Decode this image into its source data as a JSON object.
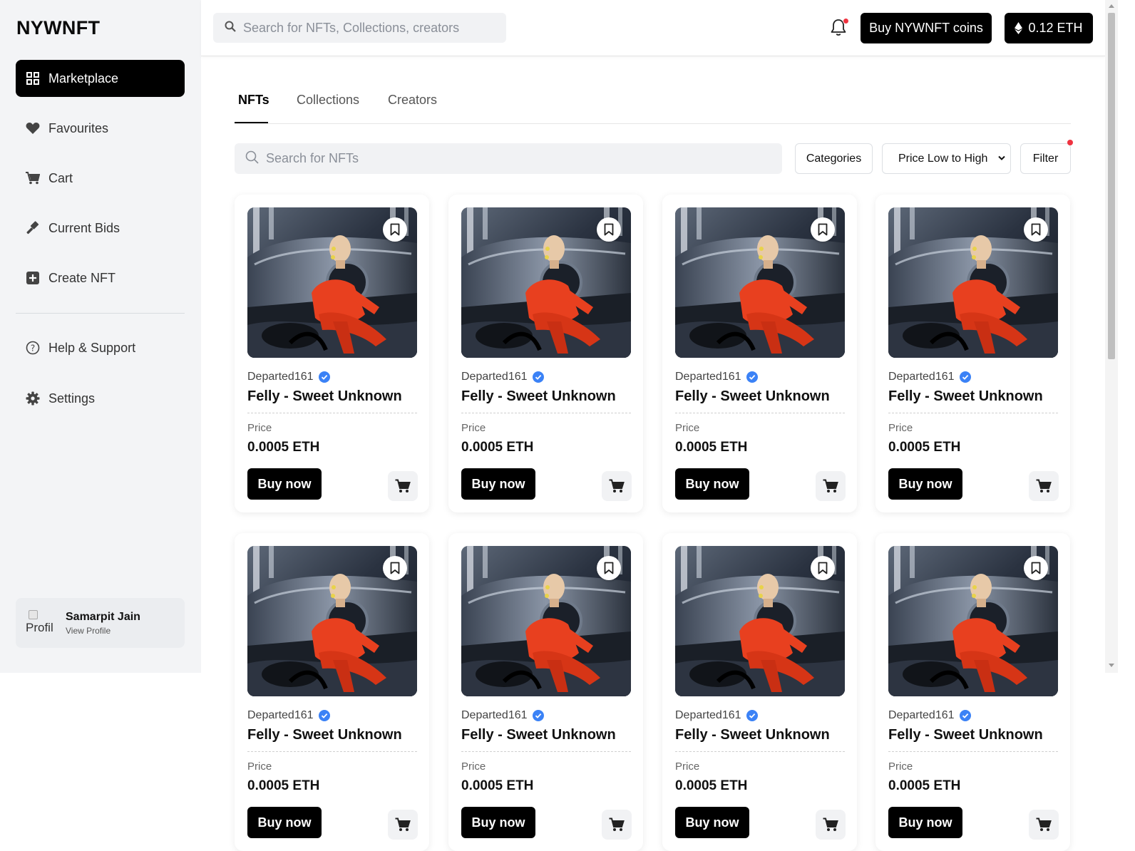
{
  "app": {
    "logo": "NYWNFT"
  },
  "sidebar": {
    "items": [
      {
        "label": "Marketplace",
        "icon": "grid-icon",
        "active": true
      },
      {
        "label": "Favourites",
        "icon": "heart-icon"
      },
      {
        "label": "Cart",
        "icon": "cart-icon"
      },
      {
        "label": "Current Bids",
        "icon": "gavel-icon"
      },
      {
        "label": "Create NFT",
        "icon": "plus-square-icon"
      }
    ],
    "secondary": [
      {
        "label": "Help & Support",
        "icon": "help-circle-icon"
      },
      {
        "label": "Settings",
        "icon": "gear-icon"
      }
    ],
    "profile": {
      "name": "Samarpit Jain",
      "link": "View Profile",
      "avatar_alt": "Profil"
    }
  },
  "topbar": {
    "search_placeholder": "Search for NFTs, Collections, creators",
    "buy_coins": "Buy NYWNFT coins",
    "balance": "0.12 ETH"
  },
  "tabs": [
    {
      "label": "NFTs",
      "active": true
    },
    {
      "label": "Collections"
    },
    {
      "label": "Creators"
    }
  ],
  "controls": {
    "search_placeholder": "Search for NFTs",
    "categories": "Categories",
    "sort": "Price Low to High",
    "filter": "Filter"
  },
  "cards": [
    {
      "creator": "Departed161",
      "title": "Felly - Sweet Unknown",
      "price_label": "Price",
      "price": "0.0005 ETH",
      "buy": "Buy now"
    },
    {
      "creator": "Departed161",
      "title": "Felly - Sweet Unknown",
      "price_label": "Price",
      "price": "0.0005 ETH",
      "buy": "Buy now"
    },
    {
      "creator": "Departed161",
      "title": "Felly - Sweet Unknown",
      "price_label": "Price",
      "price": "0.0005 ETH",
      "buy": "Buy now"
    },
    {
      "creator": "Departed161",
      "title": "Felly - Sweet Unknown",
      "price_label": "Price",
      "price": "0.0005 ETH",
      "buy": "Buy now"
    },
    {
      "creator": "Departed161",
      "title": "Felly - Sweet Unknown",
      "price_label": "Price",
      "price": "0.0005 ETH",
      "buy": "Buy now"
    },
    {
      "creator": "Departed161",
      "title": "Felly - Sweet Unknown",
      "price_label": "Price",
      "price": "0.0005 ETH",
      "buy": "Buy now"
    },
    {
      "creator": "Departed161",
      "title": "Felly - Sweet Unknown",
      "price_label": "Price",
      "price": "0.0005 ETH",
      "buy": "Buy now"
    },
    {
      "creator": "Departed161",
      "title": "Felly - Sweet Unknown",
      "price_label": "Price",
      "price": "0.0005 ETH",
      "buy": "Buy now"
    }
  ],
  "colors": {
    "accent": "#000000",
    "verified": "#3b82f6",
    "notify": "#ef3340",
    "sidebar_bg": "#f3f4f6"
  }
}
